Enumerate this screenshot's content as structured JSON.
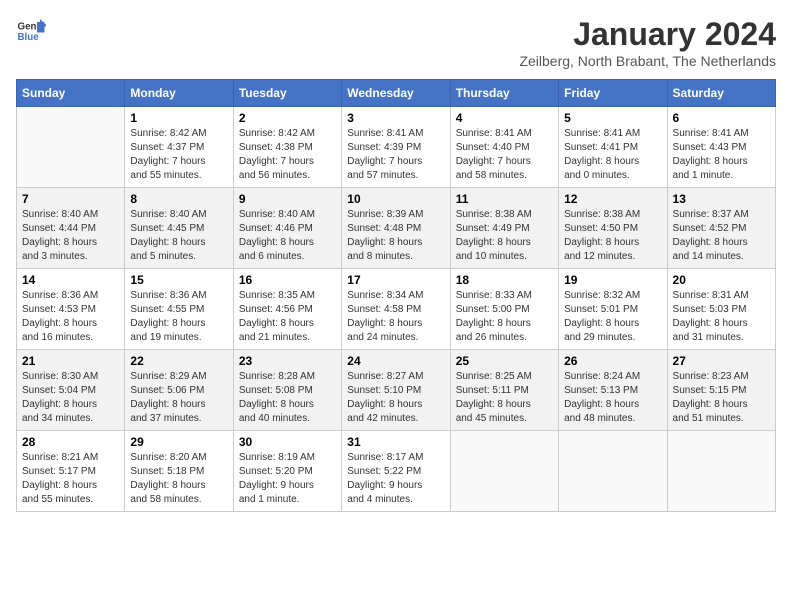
{
  "header": {
    "logo_line1": "General",
    "logo_line2": "Blue",
    "title": "January 2024",
    "subtitle": "Zeilberg, North Brabant, The Netherlands"
  },
  "weekdays": [
    "Sunday",
    "Monday",
    "Tuesday",
    "Wednesday",
    "Thursday",
    "Friday",
    "Saturday"
  ],
  "weeks": [
    [
      {
        "day": "",
        "info": ""
      },
      {
        "day": "1",
        "info": "Sunrise: 8:42 AM\nSunset: 4:37 PM\nDaylight: 7 hours\nand 55 minutes."
      },
      {
        "day": "2",
        "info": "Sunrise: 8:42 AM\nSunset: 4:38 PM\nDaylight: 7 hours\nand 56 minutes."
      },
      {
        "day": "3",
        "info": "Sunrise: 8:41 AM\nSunset: 4:39 PM\nDaylight: 7 hours\nand 57 minutes."
      },
      {
        "day": "4",
        "info": "Sunrise: 8:41 AM\nSunset: 4:40 PM\nDaylight: 7 hours\nand 58 minutes."
      },
      {
        "day": "5",
        "info": "Sunrise: 8:41 AM\nSunset: 4:41 PM\nDaylight: 8 hours\nand 0 minutes."
      },
      {
        "day": "6",
        "info": "Sunrise: 8:41 AM\nSunset: 4:43 PM\nDaylight: 8 hours\nand 1 minute."
      }
    ],
    [
      {
        "day": "7",
        "info": "Sunrise: 8:40 AM\nSunset: 4:44 PM\nDaylight: 8 hours\nand 3 minutes."
      },
      {
        "day": "8",
        "info": "Sunrise: 8:40 AM\nSunset: 4:45 PM\nDaylight: 8 hours\nand 5 minutes."
      },
      {
        "day": "9",
        "info": "Sunrise: 8:40 AM\nSunset: 4:46 PM\nDaylight: 8 hours\nand 6 minutes."
      },
      {
        "day": "10",
        "info": "Sunrise: 8:39 AM\nSunset: 4:48 PM\nDaylight: 8 hours\nand 8 minutes."
      },
      {
        "day": "11",
        "info": "Sunrise: 8:38 AM\nSunset: 4:49 PM\nDaylight: 8 hours\nand 10 minutes."
      },
      {
        "day": "12",
        "info": "Sunrise: 8:38 AM\nSunset: 4:50 PM\nDaylight: 8 hours\nand 12 minutes."
      },
      {
        "day": "13",
        "info": "Sunrise: 8:37 AM\nSunset: 4:52 PM\nDaylight: 8 hours\nand 14 minutes."
      }
    ],
    [
      {
        "day": "14",
        "info": "Sunrise: 8:36 AM\nSunset: 4:53 PM\nDaylight: 8 hours\nand 16 minutes."
      },
      {
        "day": "15",
        "info": "Sunrise: 8:36 AM\nSunset: 4:55 PM\nDaylight: 8 hours\nand 19 minutes."
      },
      {
        "day": "16",
        "info": "Sunrise: 8:35 AM\nSunset: 4:56 PM\nDaylight: 8 hours\nand 21 minutes."
      },
      {
        "day": "17",
        "info": "Sunrise: 8:34 AM\nSunset: 4:58 PM\nDaylight: 8 hours\nand 24 minutes."
      },
      {
        "day": "18",
        "info": "Sunrise: 8:33 AM\nSunset: 5:00 PM\nDaylight: 8 hours\nand 26 minutes."
      },
      {
        "day": "19",
        "info": "Sunrise: 8:32 AM\nSunset: 5:01 PM\nDaylight: 8 hours\nand 29 minutes."
      },
      {
        "day": "20",
        "info": "Sunrise: 8:31 AM\nSunset: 5:03 PM\nDaylight: 8 hours\nand 31 minutes."
      }
    ],
    [
      {
        "day": "21",
        "info": "Sunrise: 8:30 AM\nSunset: 5:04 PM\nDaylight: 8 hours\nand 34 minutes."
      },
      {
        "day": "22",
        "info": "Sunrise: 8:29 AM\nSunset: 5:06 PM\nDaylight: 8 hours\nand 37 minutes."
      },
      {
        "day": "23",
        "info": "Sunrise: 8:28 AM\nSunset: 5:08 PM\nDaylight: 8 hours\nand 40 minutes."
      },
      {
        "day": "24",
        "info": "Sunrise: 8:27 AM\nSunset: 5:10 PM\nDaylight: 8 hours\nand 42 minutes."
      },
      {
        "day": "25",
        "info": "Sunrise: 8:25 AM\nSunset: 5:11 PM\nDaylight: 8 hours\nand 45 minutes."
      },
      {
        "day": "26",
        "info": "Sunrise: 8:24 AM\nSunset: 5:13 PM\nDaylight: 8 hours\nand 48 minutes."
      },
      {
        "day": "27",
        "info": "Sunrise: 8:23 AM\nSunset: 5:15 PM\nDaylight: 8 hours\nand 51 minutes."
      }
    ],
    [
      {
        "day": "28",
        "info": "Sunrise: 8:21 AM\nSunset: 5:17 PM\nDaylight: 8 hours\nand 55 minutes."
      },
      {
        "day": "29",
        "info": "Sunrise: 8:20 AM\nSunset: 5:18 PM\nDaylight: 8 hours\nand 58 minutes."
      },
      {
        "day": "30",
        "info": "Sunrise: 8:19 AM\nSunset: 5:20 PM\nDaylight: 9 hours\nand 1 minute."
      },
      {
        "day": "31",
        "info": "Sunrise: 8:17 AM\nSunset: 5:22 PM\nDaylight: 9 hours\nand 4 minutes."
      },
      {
        "day": "",
        "info": ""
      },
      {
        "day": "",
        "info": ""
      },
      {
        "day": "",
        "info": ""
      }
    ]
  ]
}
